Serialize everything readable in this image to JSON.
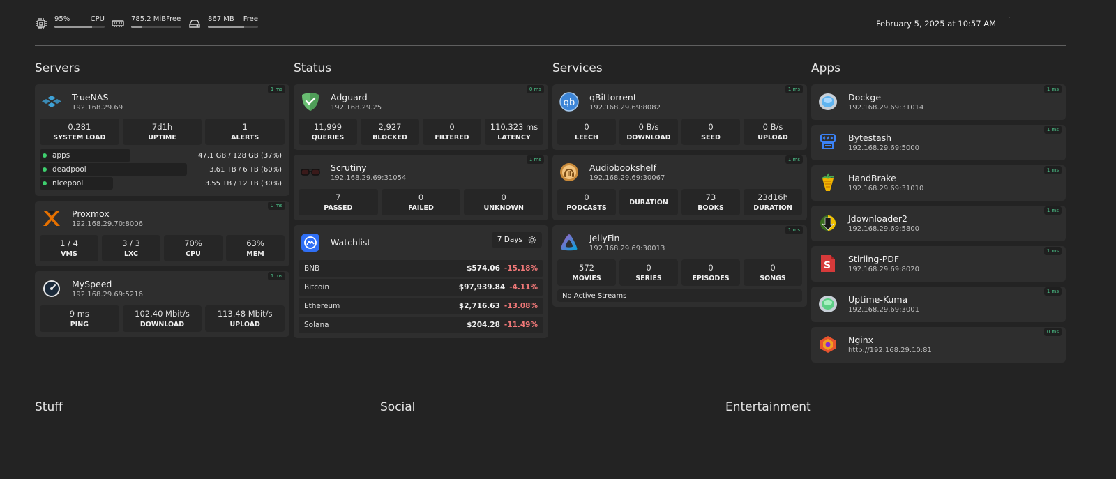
{
  "topbar": {
    "cpu": {
      "value": "95%",
      "label": "CPU",
      "fill": 0.75,
      "icon": "cpu-icon"
    },
    "memory": {
      "value": "785.2 MiB",
      "label": "Free",
      "fill": 0.22,
      "icon": "memory-icon"
    },
    "disk": {
      "value": "867 MB",
      "label": "Free",
      "fill": 0.72,
      "icon": "disk-icon"
    },
    "datetime": "February 5, 2025 at 10:57 AM",
    "dot": "·"
  },
  "columns": {
    "servers": {
      "title": "Servers"
    },
    "status": {
      "title": "Status"
    },
    "services": {
      "title": "Services"
    },
    "apps": {
      "title": "Apps"
    }
  },
  "servers": [
    {
      "name": "TrueNAS",
      "host": "192.168.29.69",
      "latency": "1 ms",
      "stats": [
        {
          "value": "0.281",
          "label": "SYSTEM LOAD"
        },
        {
          "value": "7d1h",
          "label": "UPTIME"
        },
        {
          "value": "1",
          "label": "ALERTS"
        }
      ],
      "pools": [
        {
          "name": "apps",
          "usage": "47.1 GB / 128 GB  (37%)",
          "fraction": 0.37
        },
        {
          "name": "deadpool",
          "usage": "3.61 TB / 6 TB  (60%)",
          "fraction": 0.6
        },
        {
          "name": "nicepool",
          "usage": "3.55 TB / 12 TB  (30%)",
          "fraction": 0.3
        }
      ]
    },
    {
      "name": "Proxmox",
      "host": "192.168.29.70:8006",
      "latency": "0 ms",
      "stats": [
        {
          "value": "1 / 4",
          "label": "VMS"
        },
        {
          "value": "3 / 3",
          "label": "LXC"
        },
        {
          "value": "70%",
          "label": "CPU"
        },
        {
          "value": "63%",
          "label": "MEM"
        }
      ]
    },
    {
      "name": "MySpeed",
      "host": "192.168.29.69:5216",
      "latency": "1 ms",
      "stats": [
        {
          "value": "9 ms",
          "label": "PING"
        },
        {
          "value": "102.40 Mbit/s",
          "label": "DOWNLOAD"
        },
        {
          "value": "113.48 Mbit/s",
          "label": "UPLOAD"
        }
      ]
    }
  ],
  "status": [
    {
      "name": "Adguard",
      "host": "192.168.29.25",
      "latency": "0 ms",
      "stats": [
        {
          "value": "11,999",
          "label": "QUERIES"
        },
        {
          "value": "2,927",
          "label": "BLOCKED"
        },
        {
          "value": "0",
          "label": "FILTERED"
        },
        {
          "value": "110.323 ms",
          "label": "LATENCY"
        }
      ]
    },
    {
      "name": "Scrutiny",
      "host": "192.168.29.69:31054",
      "latency": "1 ms",
      "stats": [
        {
          "value": "7",
          "label": "PASSED"
        },
        {
          "value": "0",
          "label": "FAILED"
        },
        {
          "value": "0",
          "label": "UNKNOWN"
        }
      ]
    }
  ],
  "watchlist": {
    "name": "Watchlist",
    "range": "7 Days",
    "items": [
      {
        "name": "BNB",
        "price": "$574.06",
        "change": "-15.18%"
      },
      {
        "name": "Bitcoin",
        "price": "$97,939.84",
        "change": "-4.11%"
      },
      {
        "name": "Ethereum",
        "price": "$2,716.63",
        "change": "-13.08%"
      },
      {
        "name": "Solana",
        "price": "$204.28",
        "change": "-11.49%"
      }
    ]
  },
  "services": [
    {
      "name": "qBittorrent",
      "host": "192.168.29.69:8082",
      "latency": "1 ms",
      "stats": [
        {
          "value": "0",
          "label": "LEECH"
        },
        {
          "value": "0 B/s",
          "label": "DOWNLOAD"
        },
        {
          "value": "0",
          "label": "SEED"
        },
        {
          "value": "0 B/s",
          "label": "UPLOAD"
        }
      ]
    },
    {
      "name": "Audiobookshelf",
      "host": "192.168.29.69:30067",
      "latency": "1 ms",
      "stats": [
        {
          "value": "0",
          "label": "PODCASTS"
        },
        {
          "value": "",
          "label": "DURATION"
        },
        {
          "value": "73",
          "label": "BOOKS"
        },
        {
          "value": "23d16h",
          "label": "DURATION"
        }
      ]
    },
    {
      "name": "JellyFin",
      "host": "192.168.29.69:30013",
      "latency": "1 ms",
      "stats": [
        {
          "value": "572",
          "label": "MOVIES"
        },
        {
          "value": "0",
          "label": "SERIES"
        },
        {
          "value": "0",
          "label": "EPISODES"
        },
        {
          "value": "0",
          "label": "SONGS"
        }
      ],
      "streams": "No Active Streams"
    }
  ],
  "apps": [
    {
      "name": "Dockge",
      "host": "192.168.29.69:31014",
      "latency": "1 ms",
      "icon": "dockge-icon"
    },
    {
      "name": "Bytestash",
      "host": "192.168.29.69:5000",
      "latency": "1 ms",
      "icon": "bytestash-icon"
    },
    {
      "name": "HandBrake",
      "host": "192.168.29.69:31010",
      "latency": "1 ms",
      "icon": "handbrake-icon"
    },
    {
      "name": "Jdownloader2",
      "host": "192.168.29.69:5800",
      "latency": "1 ms",
      "icon": "jdownloader-icon"
    },
    {
      "name": "Stirling-PDF",
      "host": "192.168.29.69:8020",
      "latency": "1 ms",
      "icon": "stirling-pdf-icon"
    },
    {
      "name": "Uptime-Kuma",
      "host": "192.168.29.69:3001",
      "latency": "1 ms",
      "icon": "uptime-kuma-icon"
    },
    {
      "name": "Nginx",
      "host": "http://192.168.29.10:81",
      "latency": "0 ms",
      "icon": "nginx-icon"
    }
  ],
  "bottom": {
    "stuff": "Stuff",
    "social": "Social",
    "entertainment": "Entertainment"
  }
}
